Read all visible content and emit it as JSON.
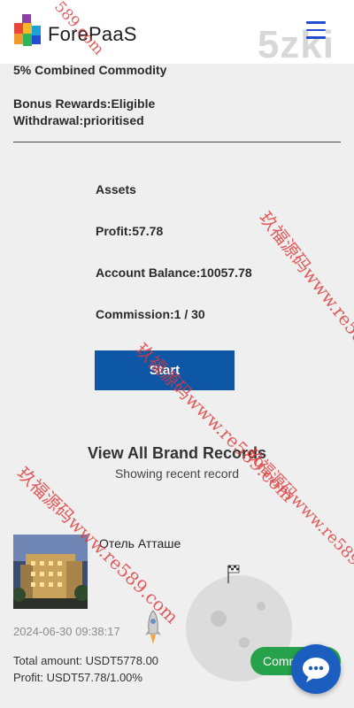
{
  "header": {
    "logo_text": "ForePaaS",
    "menu_icon": "hamburger-icon",
    "overlay_text": "5zki"
  },
  "info": {
    "line1": "5% Combined Commodity",
    "bonus": "Bonus Rewards:Eligible",
    "withdrawal": "Withdrawal:prioritised"
  },
  "assets": {
    "heading": "Assets",
    "profit": "Profit:57.78",
    "balance": "Account Balance:10057.78",
    "commission": "Commission:1 / 30"
  },
  "start_button": {
    "label": "Start"
  },
  "records": {
    "title": "View All Brand Records",
    "subtitle": "Showing recent record",
    "item": {
      "name": "Отель Атташе",
      "time": "2024-06-30 09:38:17",
      "total_amount": "Total amount:  USDT5778.00",
      "profit": "Profit:  USDT57.78/1.00%",
      "button_label": "Commit"
    }
  },
  "chat": {
    "icon": "chat-bubble-icon"
  },
  "watermarks": {
    "w1": "玖福源码www.re589.com",
    "w2": "玖福源码www.re589.com",
    "w3": "玖福源码www.re589.com",
    "w4": "玖福源码www.re589.com",
    "w5": "589.com"
  },
  "colors": {
    "brand_blue": "#0d57a6",
    "commit_green": "#25a24a",
    "chat_blue": "#1b5ec0",
    "watermark_red": "#e03a3a"
  }
}
